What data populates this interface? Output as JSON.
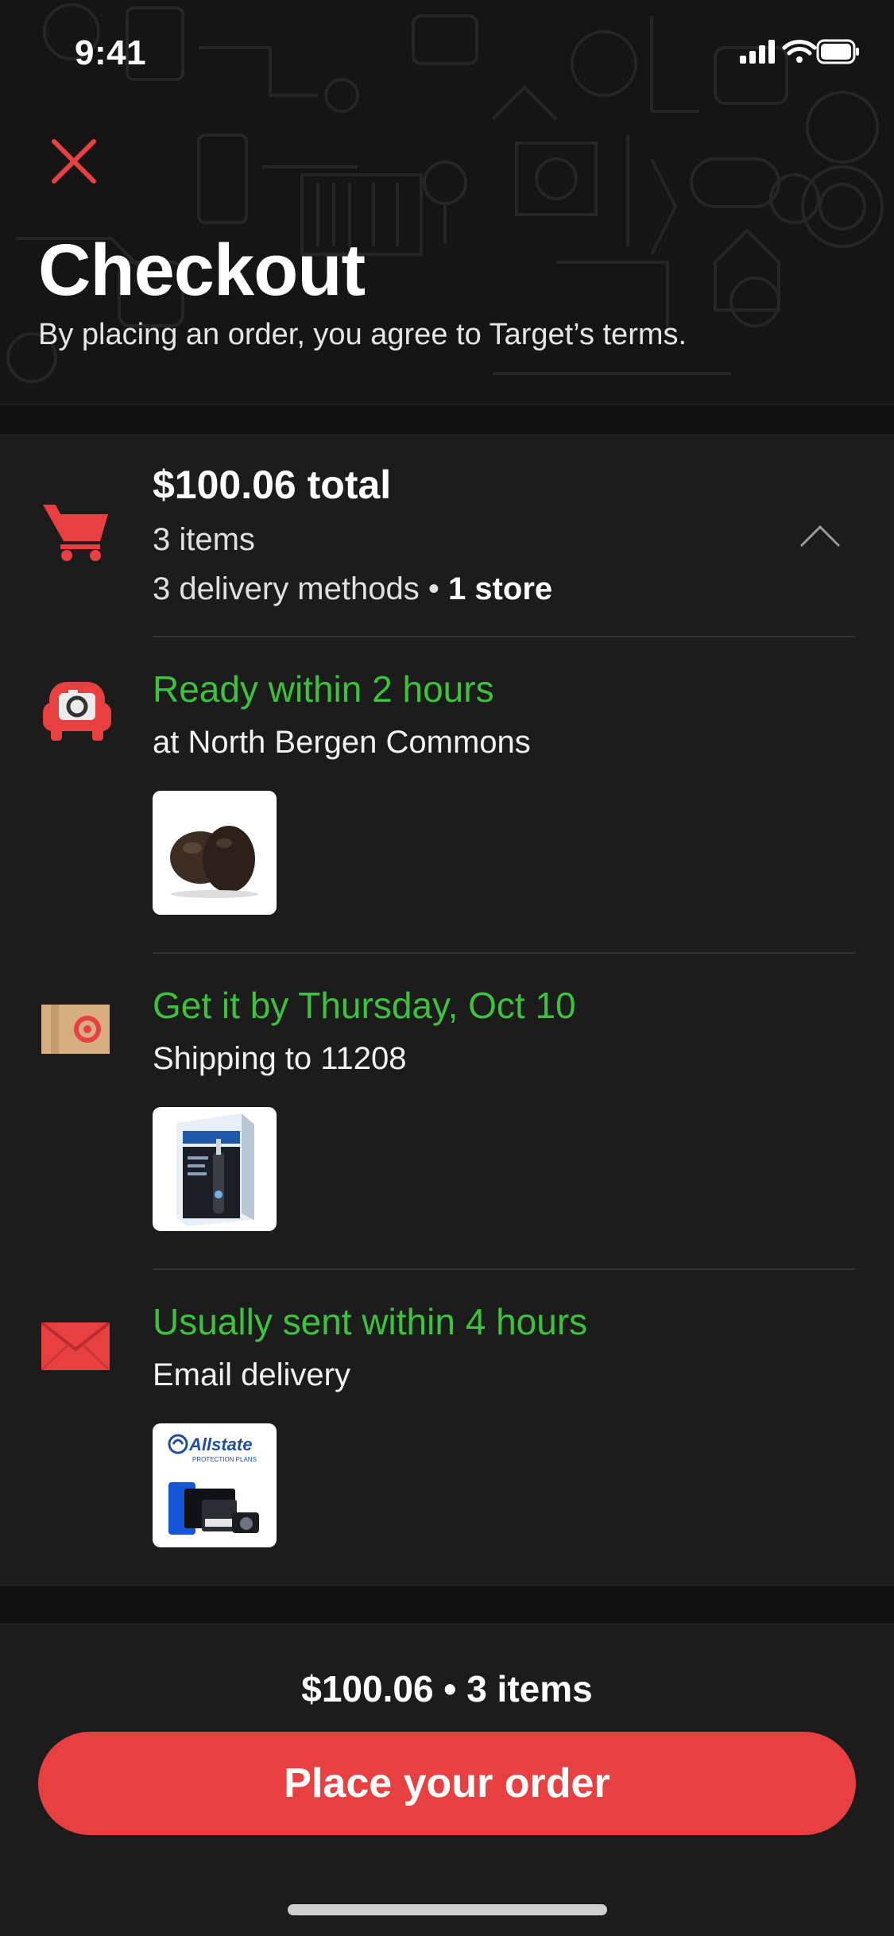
{
  "status_bar": {
    "time": "9:41"
  },
  "header": {
    "title": "Checkout",
    "subtitle": "By placing an order, you agree to Target’s terms."
  },
  "summary": {
    "total": "$100.06 total",
    "items": "3 items",
    "methods_prefix": "3 delivery methods • ",
    "methods_store": "1 store"
  },
  "fulfillment": [
    {
      "heading": "Ready within 2 hours",
      "detail": "at North Bergen Commons",
      "icon": "pickup-car-icon",
      "thumb": "avocados-image"
    },
    {
      "heading": "Get it by Thursday, Oct 10",
      "detail": "Shipping to 11208",
      "icon": "shipping-box-icon",
      "thumb": "toothbrush-box-image"
    },
    {
      "heading": "Usually sent within 4 hours",
      "detail": "Email delivery",
      "icon": "email-envelope-icon",
      "thumb": "allstate-protection-plan-image",
      "thumb_text": "Allstate",
      "thumb_subtext": "PROTECTION PLANS"
    }
  ],
  "footer": {
    "order_summary": "$100.06 • 3 items",
    "place_order": "Place your order"
  },
  "colors": {
    "accent": "#e84040",
    "status_green": "#3dc23d",
    "background": "#1c1c1c"
  }
}
